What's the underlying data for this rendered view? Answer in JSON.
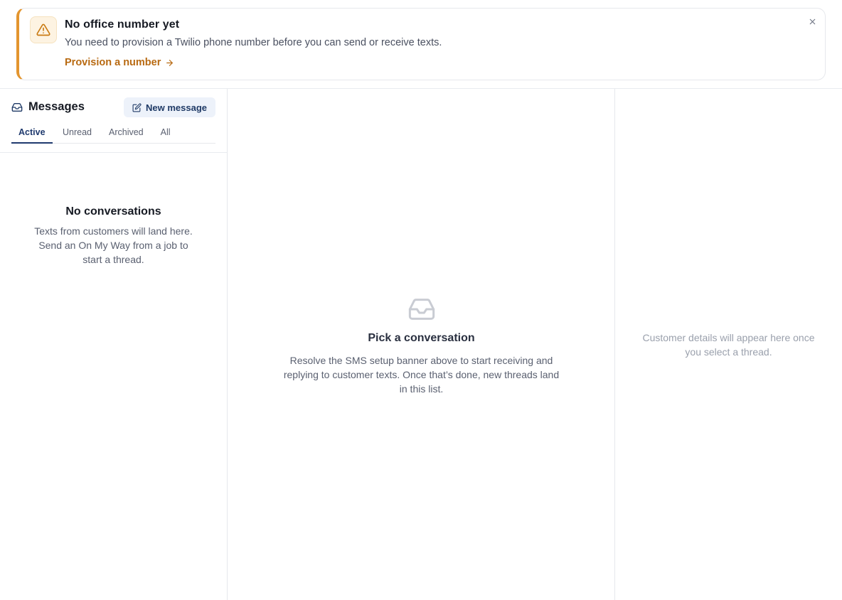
{
  "banner": {
    "title": "No office number yet",
    "text": "You need to provision a Twilio phone number before you can send or receive texts.",
    "link_label": "Provision a number",
    "icon": "warning-triangle-icon",
    "accent_color": "#e3952f"
  },
  "messages": {
    "title": "Messages",
    "new_message_label": "New message",
    "tabs": [
      {
        "label": "Active",
        "active": true
      },
      {
        "label": "Unread",
        "active": false
      },
      {
        "label": "Archived",
        "active": false
      },
      {
        "label": "All",
        "active": false
      }
    ],
    "empty_title": "No conversations",
    "empty_text": "Texts from customers will land here. Send an On My Way from a job to start a thread."
  },
  "main": {
    "empty_title": "Pick a conversation",
    "empty_text": "Resolve the SMS setup banner above to start receiving and replying to customer texts. Once that’s done, new threads land in this list."
  },
  "side": {
    "placeholder": "Customer details will appear here once you select a thread."
  }
}
